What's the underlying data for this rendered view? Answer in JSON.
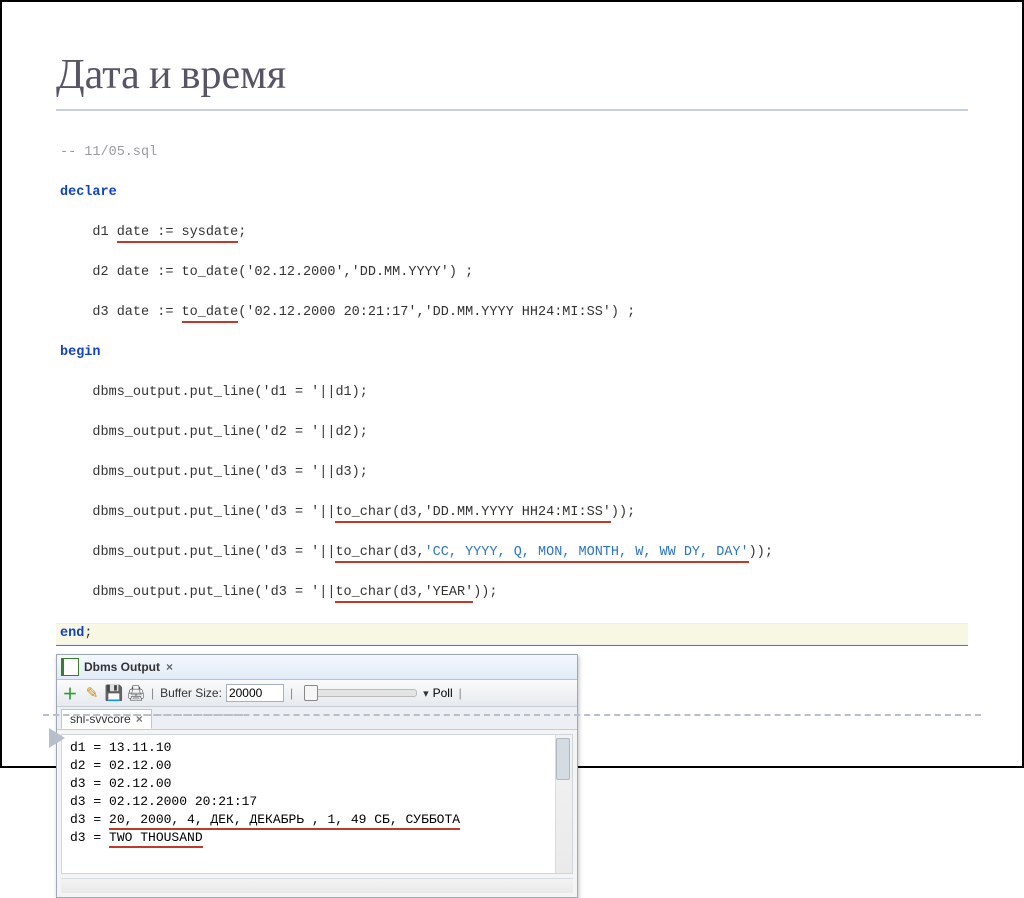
{
  "title": "Дата и время",
  "code": {
    "comment": "-- 11/05.sql",
    "kw_declare": "declare",
    "kw_begin": "begin",
    "kw_end": "end",
    "d1_pre": "    d1 ",
    "d1_decl": "date := sysdate",
    "d2_line": "    d2 date := to_date('02.12.2000','DD.MM.YYYY') ;",
    "d3_pre1": "    d3 date := ",
    "d3_func": "to_date",
    "d3_args": "('02.12.2000 20:21:17','DD.MM.YYYY HH24:MI:SS') ;",
    "out_d1": "    dbms_output.put_line('d1 = '||d1);",
    "out_d2": "    dbms_output.put_line('d2 = '||d2);",
    "out_d3a": "    dbms_output.put_line('d3 = '||d3);",
    "out_d3b_pre": "    dbms_output.put_line('d3 = '||",
    "out_d3b_u": "to_char(d3,'DD.MM.YYYY HH24:MI:SS'",
    "out_d3b_suf": "));",
    "out_d3c_pre": "    dbms_output.put_line('d3 = '||",
    "out_d3c_u1": "to_char(d3,",
    "out_d3c_u2": "'CC, YYYY, Q, MON, MONTH, W, WW DY, DAY'",
    "out_d3c_suf": "));",
    "out_d3d_pre": "    dbms_output.put_line('d3 = '||",
    "out_d3d_u": "to_char(d3,'YEAR'",
    "out_d3d_suf": "));"
  },
  "panel": {
    "title": "Dbms Output",
    "close": "×",
    "buffer_label": "Buffer Size:",
    "buffer_value": "20000",
    "poll_label": "Poll",
    "sep": "|",
    "subtab": "shl-svvcore",
    "subtab_close": "×"
  },
  "output": {
    "l1": "d1 = 13.11.10",
    "l2": "d2 = 02.12.00",
    "l3": "d3 = 02.12.00",
    "l4": "d3 = 02.12.2000 20:21:17",
    "l5_pre": "d3 = ",
    "l5_u": "20, 2000, 4, ДЕК, ДЕКАБРЬ , 1, 49 СБ, СУББОТА",
    "l6_pre": "d3 = ",
    "l6_u": "TWO THOUSAND"
  }
}
